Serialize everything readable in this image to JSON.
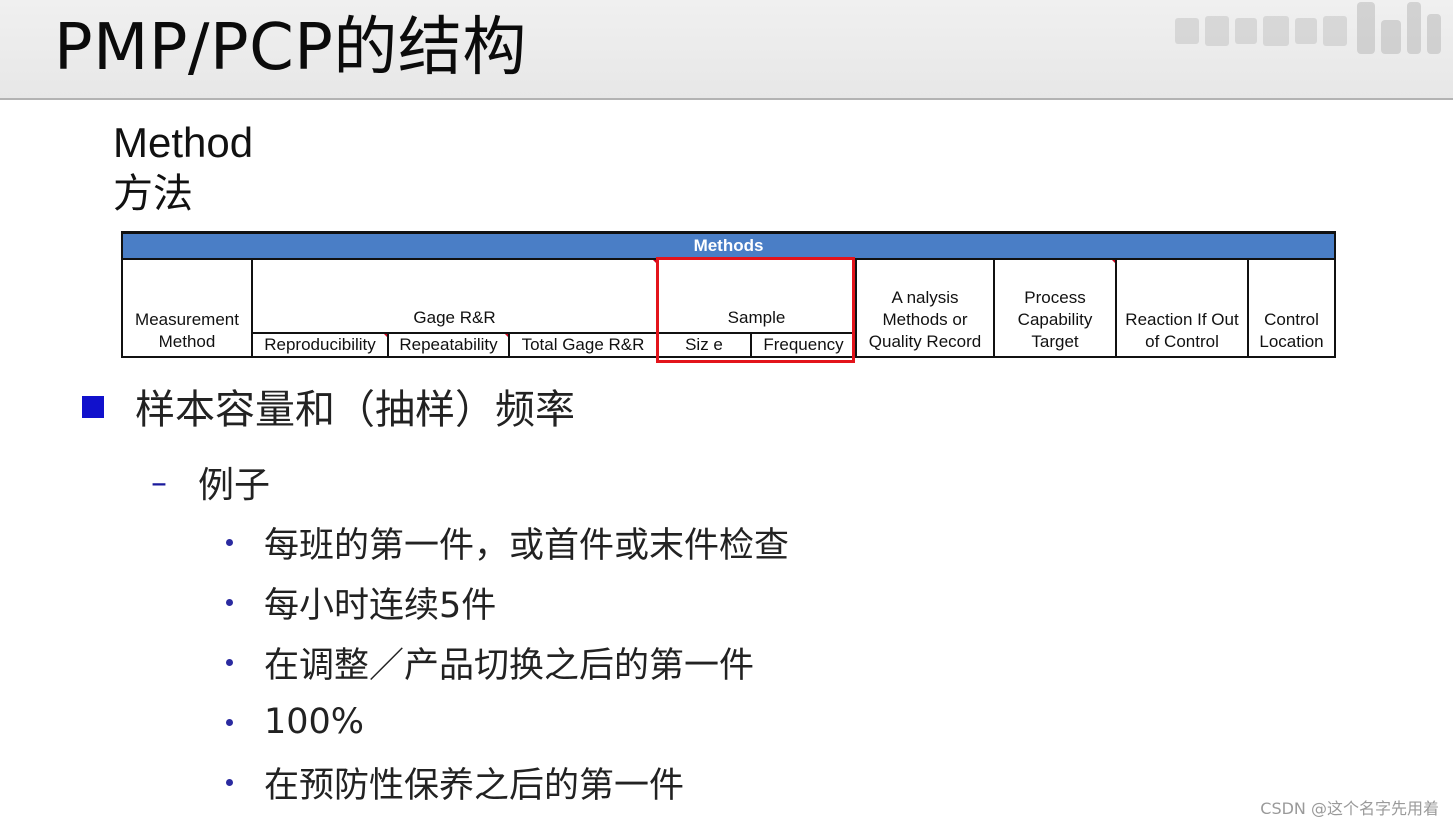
{
  "slide": {
    "title": "PMP/PCP的结构",
    "method_en": "Method",
    "method_zh": "方法"
  },
  "methods_table": {
    "band_label": "Methods",
    "headers": {
      "measurement_method": "Measurement Method",
      "gage_rr": "Gage R&R",
      "reproducibility": "Reproducibility",
      "repeatability": "Repeatability",
      "total_gage_rr": "Total Gage R&R",
      "sample": "Sample",
      "size": "Siz e",
      "frequency": "Frequency",
      "analysis": "A nalysis Methods or Quality Record",
      "process_capability": "Process Capability Target",
      "reaction": "Reaction If Out of Control",
      "control_location": "Control Location"
    }
  },
  "bullets": {
    "main": "样本容量和（抽样）频率",
    "sub": "例子",
    "items": [
      "每班的第一件，或首件或末件检查",
      "每小时连续5件",
      "在调整／产品切换之后的第一件",
      "100%",
      "在预防性保养之后的第一件"
    ]
  },
  "footer": {
    "watermark": "CSDN @这个名字先用着"
  },
  "colors": {
    "band_blue": "#4a7ec6",
    "highlight_red": "#e3141b",
    "bullet_blue": "#1111cc"
  }
}
